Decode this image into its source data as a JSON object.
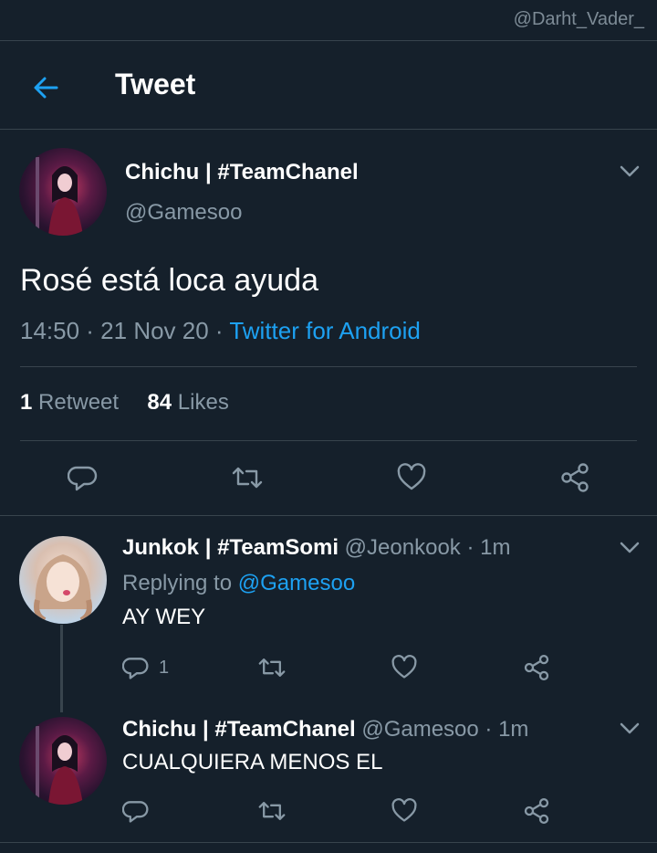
{
  "watermark": "@Darht_Vader_",
  "header": {
    "title": "Tweet"
  },
  "main_tweet": {
    "name": "Chichu | #TeamChanel",
    "handle": "@Gamesoo",
    "text": "Rosé está loca ayuda",
    "time_date": "14:50 · 21 Nov 20 · ",
    "source": "Twitter for Android",
    "retweets_count": "1",
    "retweets_label": " Retweet",
    "likes_count": "84",
    "likes_label": " Likes"
  },
  "replies": [
    {
      "name": "Junkok | #TeamSomi",
      "handle_time": " @Jeonkook · 1m",
      "replying_to_label": "Replying to ",
      "replying_to_handle": "@Gamesoo",
      "text": "AY WEY",
      "reply_count": "1"
    },
    {
      "name": "Chichu | #TeamChanel",
      "handle_time": " @Gamesoo · 1m",
      "text": "CUALQUIERA MENOS EL",
      "reply_count": ""
    }
  ],
  "icons": {
    "back": "arrow-left-icon",
    "chevron": "chevron-down-icon",
    "reply": "reply-icon",
    "retweet": "retweet-icon",
    "like": "heart-icon",
    "share": "share-icon"
  },
  "colors": {
    "background": "#15202b",
    "divider": "#38444d",
    "muted_text": "#8899a6",
    "accent": "#1da1f2",
    "text": "#ffffff"
  }
}
